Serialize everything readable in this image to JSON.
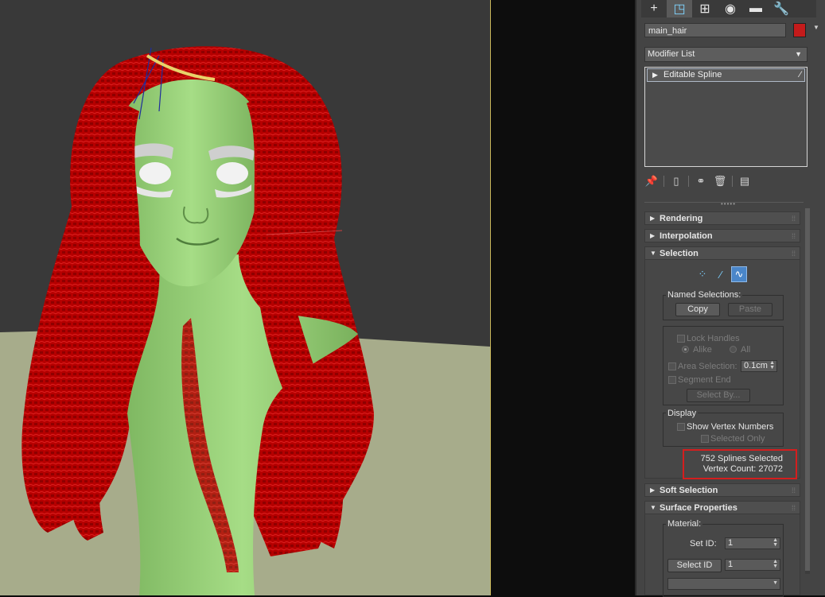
{
  "viewport": {
    "background_color": "#393939",
    "ground_color": "#a7ac8b",
    "skin_color": "#9dd57b",
    "hair_color": "#c40000"
  },
  "command_panel": {
    "tabs": [
      {
        "name": "create",
        "icon": "+"
      },
      {
        "name": "modify",
        "icon": "◳",
        "active": true
      },
      {
        "name": "hierarchy",
        "icon": "⊞"
      },
      {
        "name": "motion",
        "icon": "◉"
      },
      {
        "name": "display",
        "icon": "▬"
      },
      {
        "name": "utilities",
        "icon": "🔧"
      }
    ],
    "object_name": "main_hair",
    "object_color": "#c41b1b",
    "modifier_list_label": "Modifier List",
    "modifier_stack": [
      "Editable Spline"
    ]
  },
  "rollouts": {
    "rendering": "Rendering",
    "interpolation": "Interpolation",
    "selection": "Selection",
    "soft_selection": "Soft Selection",
    "surface_properties": "Surface Properties"
  },
  "selection": {
    "named_selections_label": "Named Selections:",
    "copy_label": "Copy",
    "paste_label": "Paste",
    "lock_handles_label": "Lock Handles",
    "alike_label": "Alike",
    "all_label": "All",
    "area_selection_label": "Area Selection:",
    "area_selection_value": "0.1cm",
    "segment_end_label": "Segment End",
    "select_by_label": "Select By...",
    "display_label": "Display",
    "show_vertex_numbers_label": "Show Vertex Numbers",
    "selected_only_label": "Selected Only",
    "status_line1": "752 Splines Selected",
    "status_line2": "Vertex Count: 27072"
  },
  "surface": {
    "material_label": "Material:",
    "set_id_label": "Set ID:",
    "set_id_value": "1",
    "select_id_label": "Select ID",
    "select_id_value": "1"
  }
}
